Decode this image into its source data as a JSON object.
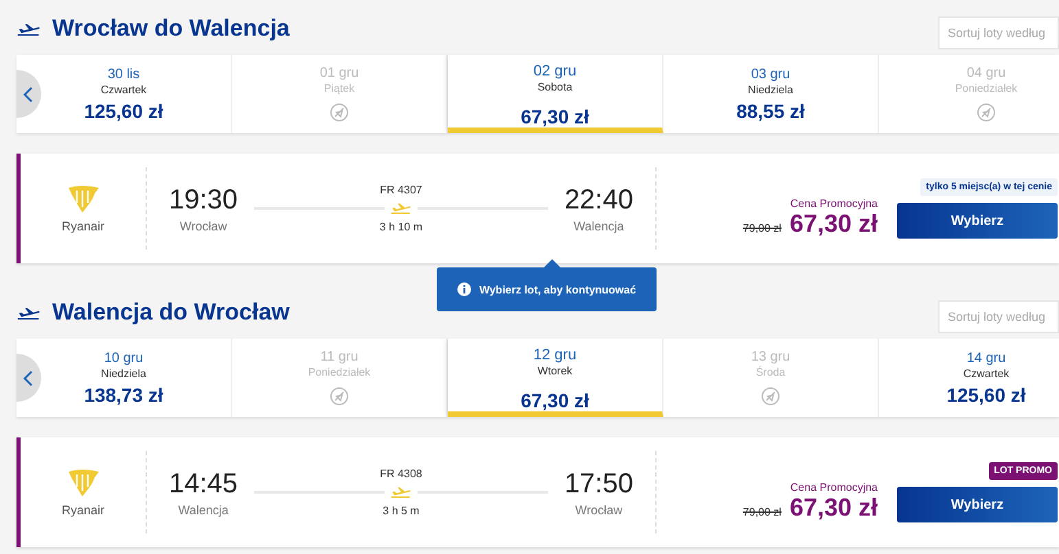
{
  "sections": [
    {
      "title": "Wrocław do Walencja",
      "sort": {
        "placeholder": "Sortuj loty według"
      },
      "days": [
        {
          "date": "30 lis",
          "weekday": "Czwartek",
          "price": "125,60 zł",
          "available": true,
          "selected": false
        },
        {
          "date": "01 gru",
          "weekday": "Piątek",
          "available": false,
          "selected": false
        },
        {
          "date": "02 gru",
          "weekday": "Sobota",
          "price": "67,30 zł",
          "available": true,
          "selected": true
        },
        {
          "date": "03 gru",
          "weekday": "Niedziela",
          "price": "88,55 zł",
          "available": true,
          "selected": false
        },
        {
          "date": "04 gru",
          "weekday": "Poniedziałek",
          "available": false,
          "selected": false
        }
      ],
      "flight": {
        "airline": "Ryanair",
        "departure": "19:30",
        "from": "Wrocław",
        "number": "FR 4307",
        "duration": "3 h 10 m",
        "arrival": "22:40",
        "to": "Walencja",
        "price_label": "Cena Promocyjna",
        "old_price": "79,00 zł",
        "price": "67,30 zł",
        "badge": {
          "kind": "seats",
          "text": "tylko 5 miejsc(a) w tej cenie"
        },
        "button": "Wybierz"
      },
      "tooltip": "Wybierz lot, aby kontynuować"
    },
    {
      "title": "Walencja do Wrocław",
      "sort": {
        "placeholder": "Sortuj loty według"
      },
      "days": [
        {
          "date": "10 gru",
          "weekday": "Niedziela",
          "price": "138,73 zł",
          "available": true,
          "selected": false
        },
        {
          "date": "11 gru",
          "weekday": "Poniedziałek",
          "available": false,
          "selected": false
        },
        {
          "date": "12 gru",
          "weekday": "Wtorek",
          "price": "67,30 zł",
          "available": true,
          "selected": true
        },
        {
          "date": "13 gru",
          "weekday": "Środa",
          "available": false,
          "selected": false
        },
        {
          "date": "14 gru",
          "weekday": "Czwartek",
          "price": "125,60 zł",
          "available": true,
          "selected": false
        }
      ],
      "flight": {
        "airline": "Ryanair",
        "departure": "14:45",
        "from": "Walencja",
        "number": "FR 4308",
        "duration": "3 h 5 m",
        "arrival": "17:50",
        "to": "Wrocław",
        "price_label": "Cena Promocyjna",
        "old_price": "79,00 zł",
        "price": "67,30 zł",
        "badge": {
          "kind": "promo",
          "text": "LOT PROMO"
        },
        "button": "Wybierz"
      }
    }
  ]
}
